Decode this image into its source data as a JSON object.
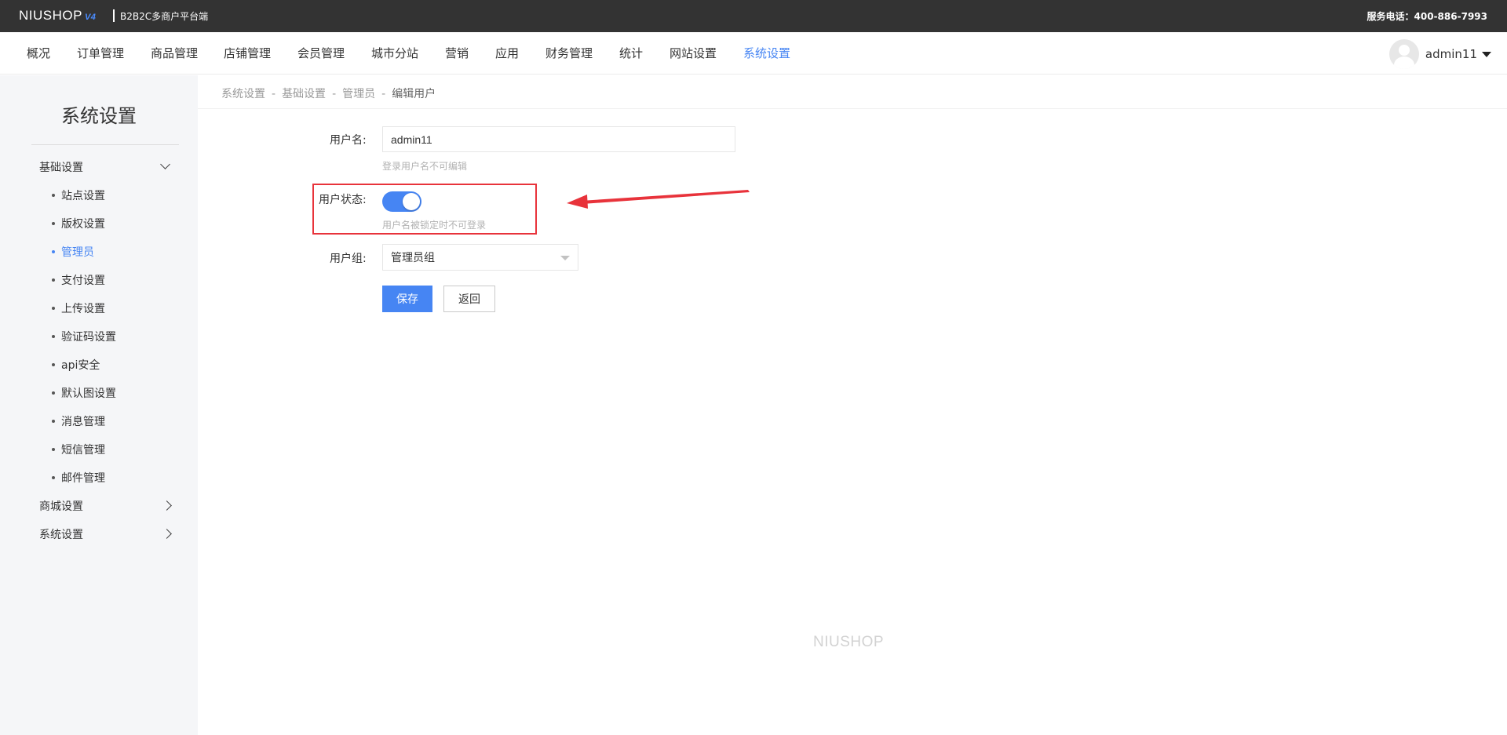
{
  "topbar": {
    "logo_text": "NIUSHOP",
    "logo_version": "V4",
    "platform_label": "B2B2C多商户平台端",
    "service_phone": "服务电话：400-886-7993"
  },
  "nav": {
    "items": [
      {
        "label": "概况"
      },
      {
        "label": "订单管理"
      },
      {
        "label": "商品管理"
      },
      {
        "label": "店铺管理"
      },
      {
        "label": "会员管理"
      },
      {
        "label": "城市分站"
      },
      {
        "label": "营销"
      },
      {
        "label": "应用"
      },
      {
        "label": "财务管理"
      },
      {
        "label": "统计"
      },
      {
        "label": "网站设置"
      },
      {
        "label": "系统设置",
        "active": true
      }
    ],
    "username": "admin11"
  },
  "sidebar": {
    "title": "系统设置",
    "groups": [
      {
        "label": "基础设置",
        "expanded": true
      },
      {
        "label": "商城设置",
        "expanded": false
      },
      {
        "label": "系统设置",
        "expanded": false
      }
    ],
    "sub_items": [
      {
        "label": "站点设置"
      },
      {
        "label": "版权设置"
      },
      {
        "label": "管理员",
        "active": true
      },
      {
        "label": "支付设置"
      },
      {
        "label": "上传设置"
      },
      {
        "label": "验证码设置"
      },
      {
        "label": "api安全"
      },
      {
        "label": "默认图设置"
      },
      {
        "label": "消息管理"
      },
      {
        "label": "短信管理"
      },
      {
        "label": "邮件管理"
      }
    ]
  },
  "breadcrumb": {
    "items": [
      "系统设置",
      "基础设置",
      "管理员",
      "编辑用户"
    ],
    "separator": "-"
  },
  "form": {
    "username_label": "用户名:",
    "username_value": "admin11",
    "username_hint": "登录用户名不可编辑",
    "status_label": "用户状态:",
    "status_on": true,
    "status_hint": "用户名被锁定时不可登录",
    "group_label": "用户组:",
    "group_value": "管理员组",
    "save_label": "保存",
    "back_label": "返回"
  },
  "footer": {
    "logo_text": "NIUSHOP"
  },
  "colors": {
    "topbar_bg": "#333333",
    "accent": "#4685f3",
    "annotation_red": "#e8333b",
    "sidebar_bg": "#f5f6f8"
  }
}
